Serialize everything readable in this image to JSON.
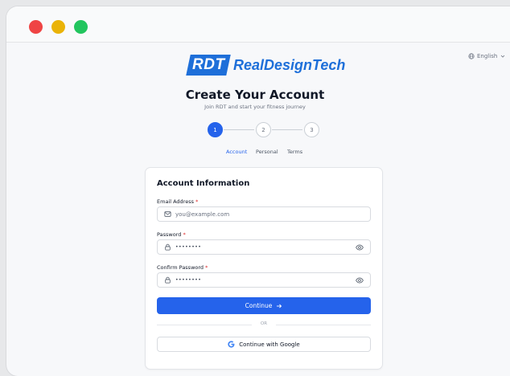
{
  "window": {
    "controls": [
      "close",
      "minimize",
      "maximize"
    ]
  },
  "language": {
    "label": "English",
    "icon": "globe-icon",
    "chevron": "chevron-down-icon"
  },
  "brand": {
    "mark": "RDT",
    "name": "RealDesignTech",
    "color": "#1e6fd9"
  },
  "header": {
    "title": "Create Your Account",
    "subtitle": "Join RDT and start your fitness journey"
  },
  "stepper": {
    "steps": [
      {
        "number": "1",
        "label": "Account",
        "active": true
      },
      {
        "number": "2",
        "label": "Personal",
        "active": false
      },
      {
        "number": "3",
        "label": "Terms",
        "active": false
      }
    ]
  },
  "form": {
    "title": "Account Information",
    "email": {
      "label": "Email Address",
      "required_mark": "*",
      "placeholder": "you@example.com",
      "icon": "mail-icon"
    },
    "password": {
      "label": "Password",
      "required_mark": "*",
      "value": "••••••••",
      "icon": "lock-icon",
      "toggle_icon": "eye-icon"
    },
    "confirm_password": {
      "label": "Confirm Password",
      "required_mark": "*",
      "value": "••••••••",
      "icon": "lock-icon",
      "toggle_icon": "eye-icon"
    },
    "continue_label": "Continue",
    "continue_icon": "arrow-right-icon",
    "divider_text": "OR",
    "google_label": "Continue with Google",
    "google_icon": "google-icon"
  },
  "colors": {
    "primary": "#2563eb",
    "required": "#dc2626",
    "close": "#ef4444",
    "minimize": "#eab308",
    "maximize": "#22c55e"
  }
}
